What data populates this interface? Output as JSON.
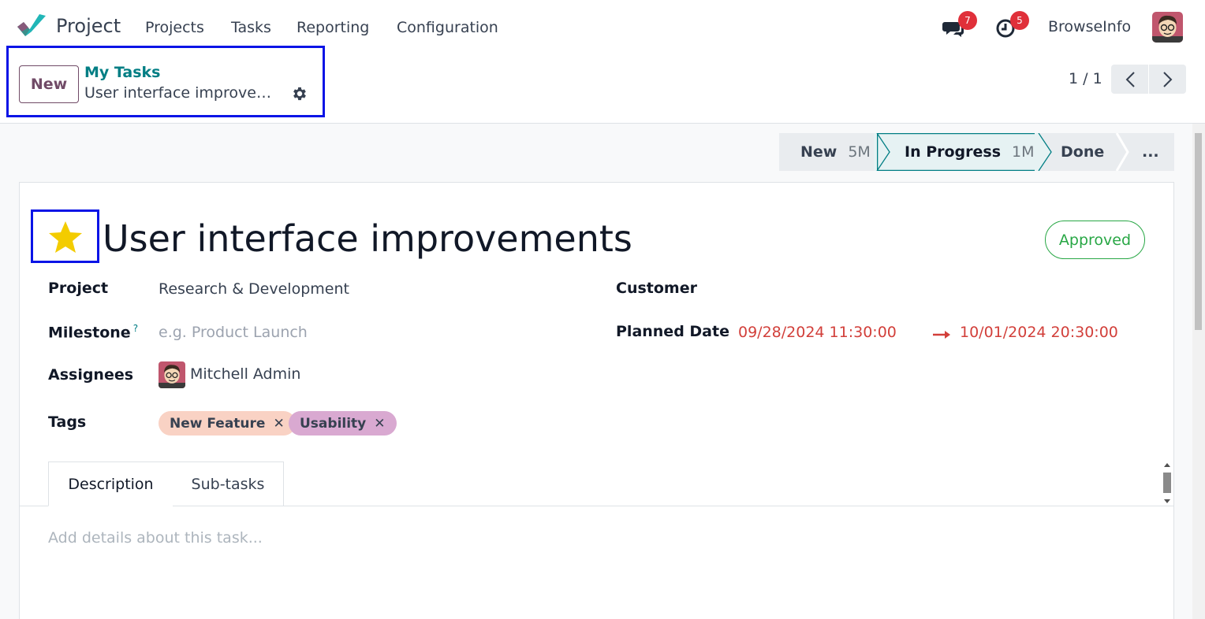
{
  "app": {
    "name": "Project"
  },
  "nav": {
    "items": [
      {
        "label": "Projects"
      },
      {
        "label": "Tasks"
      },
      {
        "label": "Reporting"
      },
      {
        "label": "Configuration"
      }
    ]
  },
  "systray": {
    "messages_count": "7",
    "activities_count": "5",
    "company": "BrowseInfo"
  },
  "control": {
    "new_label": "New",
    "breadcrumb_parent": "My Tasks",
    "breadcrumb_current": "User interface improvements",
    "pager": "1 / 1"
  },
  "stages": [
    {
      "label": "New",
      "count": "5M",
      "state": "done"
    },
    {
      "label": "In Progress",
      "count": "1M",
      "state": "current"
    },
    {
      "label": "Done",
      "count": "",
      "state": "todo"
    },
    {
      "label": "...",
      "count": "",
      "state": "more"
    }
  ],
  "task": {
    "title": "User interface improvements",
    "priority_starred": true,
    "state_label": "Approved"
  },
  "fields": {
    "project_label": "Project",
    "project_value": "Research & Development",
    "milestone_label": "Milestone",
    "milestone_help": "?",
    "milestone_placeholder": "e.g. Product Launch",
    "assignees_label": "Assignees",
    "assignee_name": "Mitchell Admin",
    "tags_label": "Tags",
    "tags": [
      {
        "label": "New Feature",
        "color": "#f9d2c4"
      },
      {
        "label": "Usability",
        "color": "#d9a9d1"
      }
    ],
    "customer_label": "Customer",
    "planned_date_label": "Planned Date",
    "planned_date_start": "09/28/2024 11:30:00",
    "planned_date_end": "10/01/2024 20:30:00"
  },
  "tabs": [
    {
      "label": "Description",
      "active": true
    },
    {
      "label": "Sub-tasks",
      "active": false
    }
  ],
  "description": {
    "placeholder": "Add details about this task..."
  },
  "colors": {
    "brand": "#714b67",
    "teal": "#017e84",
    "danger": "#d23f3a",
    "success": "#28a745",
    "highlight": "#0a14e6"
  }
}
